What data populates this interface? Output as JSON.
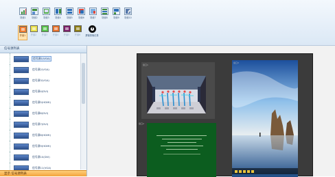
{
  "toolbar": {
    "row1": [
      {
        "icon": "bar-chart-icon",
        "label": "场景1"
      },
      {
        "icon": "layout-icon",
        "label": "场景2"
      },
      {
        "icon": "window-icon",
        "label": "场景3"
      },
      {
        "icon": "layout-icon",
        "label": "场景4"
      },
      {
        "icon": "split-icon",
        "label": "场景5"
      },
      {
        "icon": "window-icon",
        "label": "场景6"
      },
      {
        "icon": "layout-icon",
        "label": "场景7"
      },
      {
        "icon": "grid-icon",
        "label": "场景8"
      },
      {
        "icon": "layout-icon",
        "label": "场景9"
      },
      {
        "icon": "edit-icon",
        "label": "场景10"
      }
    ],
    "row2": [
      {
        "icon": "orange-square-icon",
        "label": "开窗1",
        "color": "#f07b2e",
        "selected": true
      },
      {
        "icon": "yellow-square-icon",
        "label": "开窗2",
        "color": "#e9e04a"
      },
      {
        "icon": "green-square-icon",
        "label": "开窗3",
        "color": "#55c04a"
      },
      {
        "icon": "orange-square-icon",
        "label": "开窗4",
        "color": "#e5702a"
      },
      {
        "icon": "purple-square-icon",
        "label": "开窗5",
        "color": "#7a1f68"
      },
      {
        "icon": "olive-square-icon",
        "label": "开窗6",
        "color": "#8d7d12"
      },
      {
        "icon": "record-icon",
        "label": "屏幕录像记录"
      }
    ]
  },
  "left_panel": {
    "header": "信号源列表",
    "items": [
      "信号源1(VGA)",
      "信号源2(VGA)",
      "信号源3(VGA)",
      "信号源4(DVI)",
      "信号源5(HDMI)",
      "信号源6(DVI)",
      "信号源7(DVI)",
      "信号源8(HDMI)",
      "信号源9(HDMI)",
      "信号源10(DVI)",
      "信号源11(VGA)"
    ],
    "footer": "显示 信号源列表"
  },
  "display": {
    "windows": [
      {
        "tag": "窗口1"
      },
      {
        "tag": "窗口2"
      },
      {
        "tag": "窗口3"
      }
    ]
  }
}
